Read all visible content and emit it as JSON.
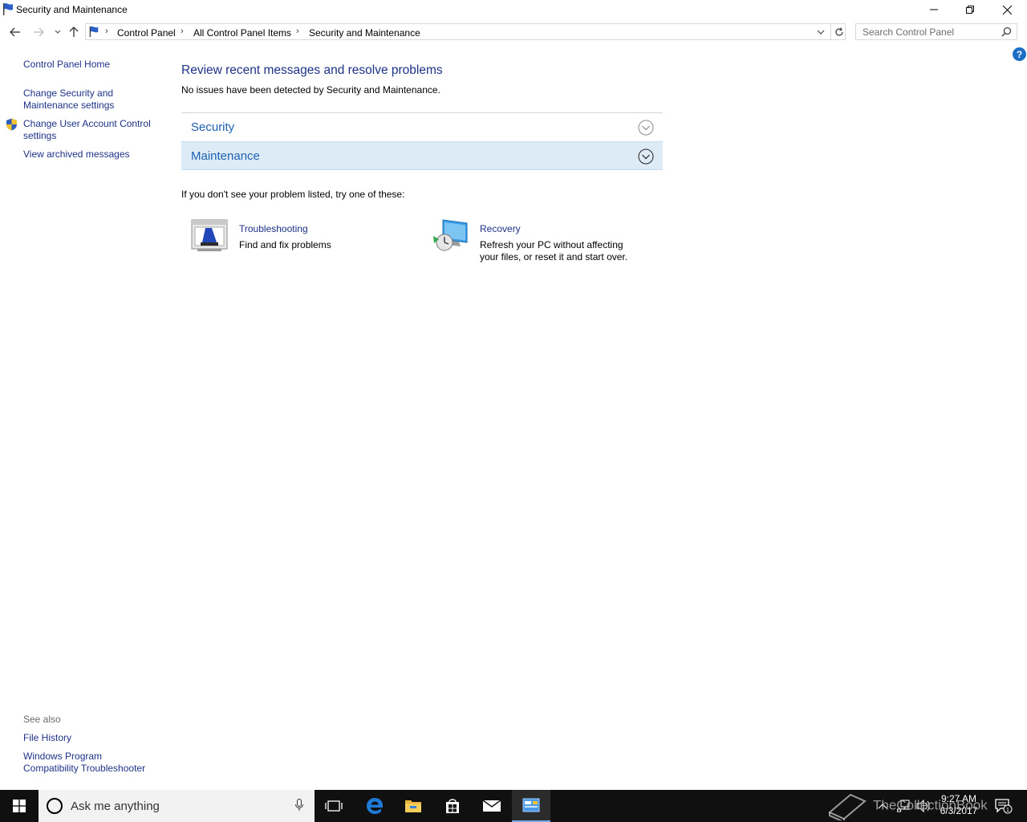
{
  "window": {
    "title": "Security and Maintenance"
  },
  "address": {
    "crumbs": [
      "Control Panel",
      "All Control Panel Items",
      "Security and Maintenance"
    ]
  },
  "search": {
    "placeholder": "Search Control Panel"
  },
  "help": {
    "label": "?"
  },
  "sidebar": {
    "items": [
      {
        "label": "Control Panel Home"
      },
      {
        "label": "Change Security and Maintenance settings"
      },
      {
        "label": "Change User Account Control settings"
      },
      {
        "label": "View archived messages"
      }
    ],
    "see_also_title": "See also",
    "see_also": [
      {
        "label": "File History"
      },
      {
        "label": "Windows Program Compatibility Troubleshooter"
      }
    ]
  },
  "main": {
    "title": "Review recent messages and resolve problems",
    "subtitle": "No issues have been detected by Security and Maintenance.",
    "sections": [
      {
        "label": "Security",
        "expanded": false
      },
      {
        "label": "Maintenance",
        "expanded": false,
        "highlighted": true
      }
    ],
    "try_text": "If you don't see your problem listed, try one of these:",
    "tasks": [
      {
        "label": "Troubleshooting",
        "description": "Find and fix problems",
        "icon": "troubleshooting-icon"
      },
      {
        "label": "Recovery",
        "description": "Refresh your PC without affecting your files, or reset it and start over.",
        "icon": "recovery-icon"
      }
    ]
  },
  "taskbar": {
    "search_placeholder": "Ask me anything",
    "time": "9:27 AM",
    "date": "6/3/2017",
    "notification_count": "1",
    "watermark": "TheCollectionBook"
  },
  "colors": {
    "link": "#1e3287",
    "section_label": "#1e62b0",
    "highlight_row": "#ddebf7",
    "taskbar": "#101010"
  }
}
